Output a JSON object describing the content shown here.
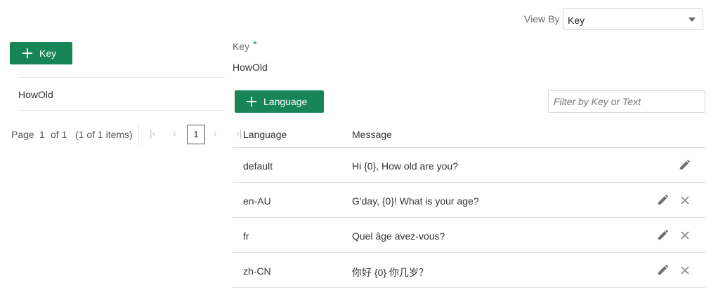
{
  "view_by": {
    "label": "View By",
    "selected": "Key"
  },
  "left": {
    "add_key_label": "Key",
    "keys": [
      "HowOld"
    ],
    "pager": {
      "page_word": "Page",
      "page": "1",
      "of_text": "of 1",
      "items_text": "(1 of 1 items)",
      "current": "1"
    }
  },
  "detail": {
    "key_label": "Key",
    "required_mark": "*",
    "key_value": "HowOld",
    "add_language_label": "Language",
    "filter_placeholder": "Filter by Key or Text",
    "columns": {
      "language": "Language",
      "message": "Message"
    },
    "rows": [
      {
        "language": "default",
        "message": "Hi {0}, How old are you?",
        "deletable": false
      },
      {
        "language": "en-AU",
        "message": "G'day, {0}! What is your age?",
        "deletable": true
      },
      {
        "language": "fr",
        "message": "Quel âge avez-vous?",
        "deletable": true
      },
      {
        "language": "zh-CN",
        "message": "你好 {0} 你几岁？",
        "deletable": true
      }
    ]
  },
  "colors": {
    "accent": "#178556"
  }
}
